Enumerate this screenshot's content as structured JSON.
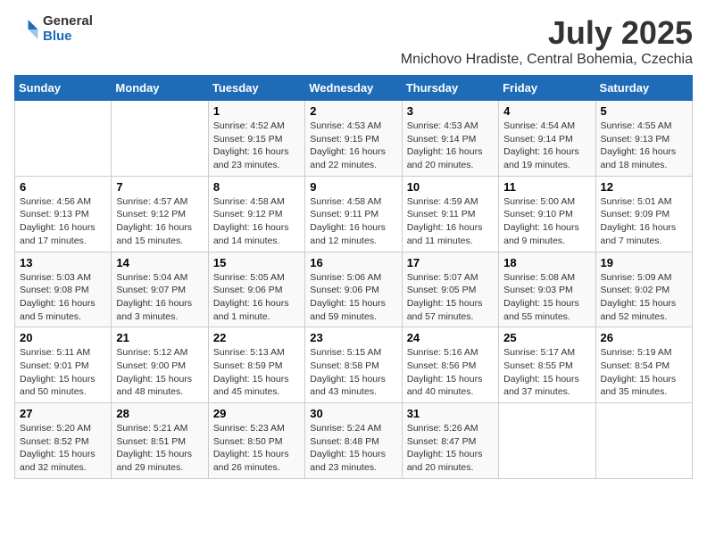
{
  "logo": {
    "general": "General",
    "blue": "Blue"
  },
  "title": "July 2025",
  "subtitle": "Mnichovo Hradiste, Central Bohemia, Czechia",
  "days_of_week": [
    "Sunday",
    "Monday",
    "Tuesday",
    "Wednesday",
    "Thursday",
    "Friday",
    "Saturday"
  ],
  "weeks": [
    [
      {
        "day": "",
        "info": ""
      },
      {
        "day": "",
        "info": ""
      },
      {
        "day": "1",
        "info": "Sunrise: 4:52 AM\nSunset: 9:15 PM\nDaylight: 16 hours and 23 minutes."
      },
      {
        "day": "2",
        "info": "Sunrise: 4:53 AM\nSunset: 9:15 PM\nDaylight: 16 hours and 22 minutes."
      },
      {
        "day": "3",
        "info": "Sunrise: 4:53 AM\nSunset: 9:14 PM\nDaylight: 16 hours and 20 minutes."
      },
      {
        "day": "4",
        "info": "Sunrise: 4:54 AM\nSunset: 9:14 PM\nDaylight: 16 hours and 19 minutes."
      },
      {
        "day": "5",
        "info": "Sunrise: 4:55 AM\nSunset: 9:13 PM\nDaylight: 16 hours and 18 minutes."
      }
    ],
    [
      {
        "day": "6",
        "info": "Sunrise: 4:56 AM\nSunset: 9:13 PM\nDaylight: 16 hours and 17 minutes."
      },
      {
        "day": "7",
        "info": "Sunrise: 4:57 AM\nSunset: 9:12 PM\nDaylight: 16 hours and 15 minutes."
      },
      {
        "day": "8",
        "info": "Sunrise: 4:58 AM\nSunset: 9:12 PM\nDaylight: 16 hours and 14 minutes."
      },
      {
        "day": "9",
        "info": "Sunrise: 4:58 AM\nSunset: 9:11 PM\nDaylight: 16 hours and 12 minutes."
      },
      {
        "day": "10",
        "info": "Sunrise: 4:59 AM\nSunset: 9:11 PM\nDaylight: 16 hours and 11 minutes."
      },
      {
        "day": "11",
        "info": "Sunrise: 5:00 AM\nSunset: 9:10 PM\nDaylight: 16 hours and 9 minutes."
      },
      {
        "day": "12",
        "info": "Sunrise: 5:01 AM\nSunset: 9:09 PM\nDaylight: 16 hours and 7 minutes."
      }
    ],
    [
      {
        "day": "13",
        "info": "Sunrise: 5:03 AM\nSunset: 9:08 PM\nDaylight: 16 hours and 5 minutes."
      },
      {
        "day": "14",
        "info": "Sunrise: 5:04 AM\nSunset: 9:07 PM\nDaylight: 16 hours and 3 minutes."
      },
      {
        "day": "15",
        "info": "Sunrise: 5:05 AM\nSunset: 9:06 PM\nDaylight: 16 hours and 1 minute."
      },
      {
        "day": "16",
        "info": "Sunrise: 5:06 AM\nSunset: 9:06 PM\nDaylight: 15 hours and 59 minutes."
      },
      {
        "day": "17",
        "info": "Sunrise: 5:07 AM\nSunset: 9:05 PM\nDaylight: 15 hours and 57 minutes."
      },
      {
        "day": "18",
        "info": "Sunrise: 5:08 AM\nSunset: 9:03 PM\nDaylight: 15 hours and 55 minutes."
      },
      {
        "day": "19",
        "info": "Sunrise: 5:09 AM\nSunset: 9:02 PM\nDaylight: 15 hours and 52 minutes."
      }
    ],
    [
      {
        "day": "20",
        "info": "Sunrise: 5:11 AM\nSunset: 9:01 PM\nDaylight: 15 hours and 50 minutes."
      },
      {
        "day": "21",
        "info": "Sunrise: 5:12 AM\nSunset: 9:00 PM\nDaylight: 15 hours and 48 minutes."
      },
      {
        "day": "22",
        "info": "Sunrise: 5:13 AM\nSunset: 8:59 PM\nDaylight: 15 hours and 45 minutes."
      },
      {
        "day": "23",
        "info": "Sunrise: 5:15 AM\nSunset: 8:58 PM\nDaylight: 15 hours and 43 minutes."
      },
      {
        "day": "24",
        "info": "Sunrise: 5:16 AM\nSunset: 8:56 PM\nDaylight: 15 hours and 40 minutes."
      },
      {
        "day": "25",
        "info": "Sunrise: 5:17 AM\nSunset: 8:55 PM\nDaylight: 15 hours and 37 minutes."
      },
      {
        "day": "26",
        "info": "Sunrise: 5:19 AM\nSunset: 8:54 PM\nDaylight: 15 hours and 35 minutes."
      }
    ],
    [
      {
        "day": "27",
        "info": "Sunrise: 5:20 AM\nSunset: 8:52 PM\nDaylight: 15 hours and 32 minutes."
      },
      {
        "day": "28",
        "info": "Sunrise: 5:21 AM\nSunset: 8:51 PM\nDaylight: 15 hours and 29 minutes."
      },
      {
        "day": "29",
        "info": "Sunrise: 5:23 AM\nSunset: 8:50 PM\nDaylight: 15 hours and 26 minutes."
      },
      {
        "day": "30",
        "info": "Sunrise: 5:24 AM\nSunset: 8:48 PM\nDaylight: 15 hours and 23 minutes."
      },
      {
        "day": "31",
        "info": "Sunrise: 5:26 AM\nSunset: 8:47 PM\nDaylight: 15 hours and 20 minutes."
      },
      {
        "day": "",
        "info": ""
      },
      {
        "day": "",
        "info": ""
      }
    ]
  ]
}
